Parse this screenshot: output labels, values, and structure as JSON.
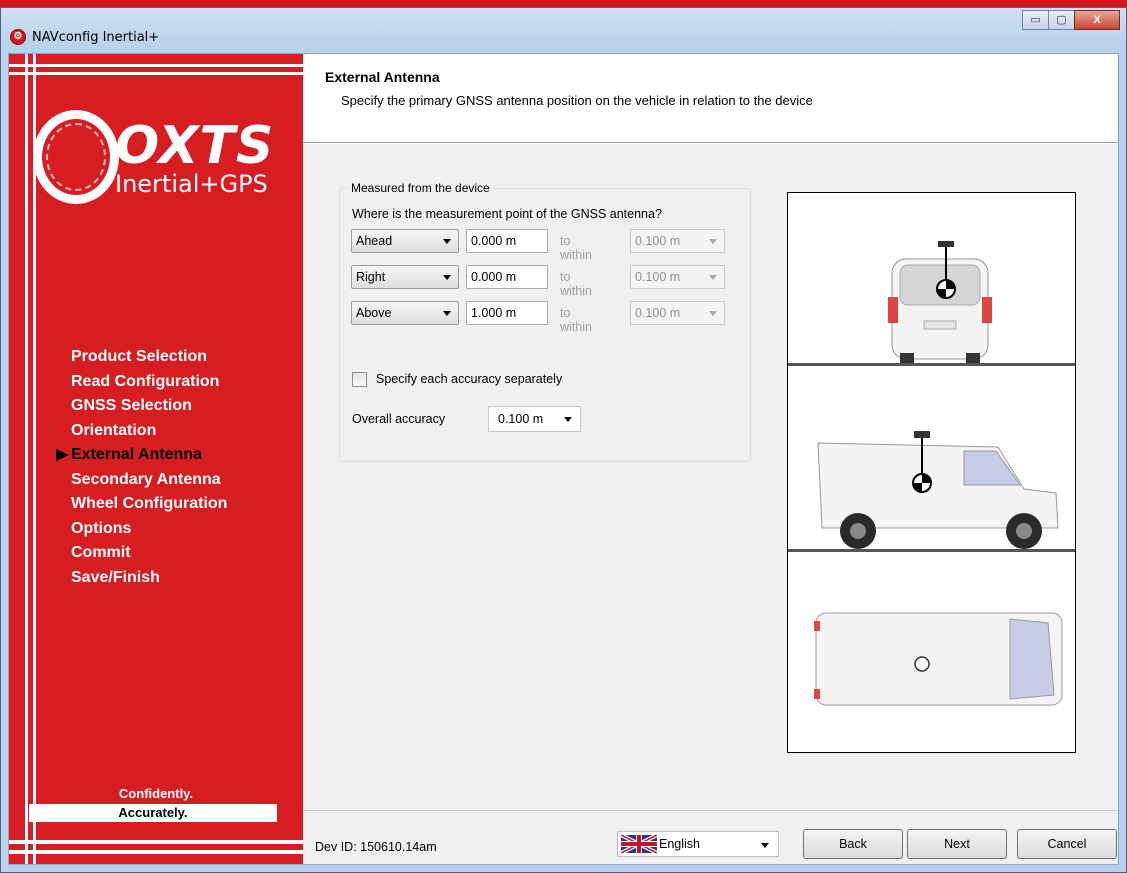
{
  "window": {
    "title": "NAVconfig Inertial+",
    "minimize": "▭",
    "maximize": "▢",
    "close": "X"
  },
  "sidebar": {
    "logo_word": "OXTS",
    "logo_sub": "Inertial+GPS",
    "items": [
      {
        "label": "Product Selection",
        "active": false
      },
      {
        "label": "Read Configuration",
        "active": false
      },
      {
        "label": "GNSS Selection",
        "active": false
      },
      {
        "label": "Orientation",
        "active": false
      },
      {
        "label": "External Antenna",
        "active": true
      },
      {
        "label": "Secondary Antenna",
        "active": false
      },
      {
        "label": "Wheel Configuration",
        "active": false
      },
      {
        "label": "Options",
        "active": false
      },
      {
        "label": "Commit",
        "active": false
      },
      {
        "label": "Save/Finish",
        "active": false
      }
    ],
    "slogan_1": "Confidently.",
    "slogan_2": "Accurately."
  },
  "header": {
    "title": "External Antenna",
    "description": "Specify the primary GNSS antenna position on the vehicle in relation to the device"
  },
  "measure": {
    "group_label": "Measured from the device",
    "question": "Where is the measurement point of the GNSS antenna?",
    "rows": [
      {
        "direction": "Ahead",
        "value": "0.000 m",
        "within_label": "to within",
        "accuracy": "0.100 m"
      },
      {
        "direction": "Right",
        "value": "0.000 m",
        "within_label": "to within",
        "accuracy": "0.100 m"
      },
      {
        "direction": "Above",
        "value": "1.000 m",
        "within_label": "to within",
        "accuracy": "0.100 m"
      }
    ],
    "separate_accuracy_label": "Specify each accuracy separately",
    "separate_accuracy_checked": false,
    "overall_accuracy_label": "Overall accuracy",
    "overall_accuracy_value": "0.100 m"
  },
  "footer": {
    "dev_id": "Dev ID: 150610.14am",
    "language": "English",
    "back": "Back",
    "next": "Next",
    "cancel": "Cancel"
  },
  "colors": {
    "brand_red": "#d61e22",
    "window_frame": "#b9d1ea",
    "panel_bg": "#f0f0f0"
  }
}
